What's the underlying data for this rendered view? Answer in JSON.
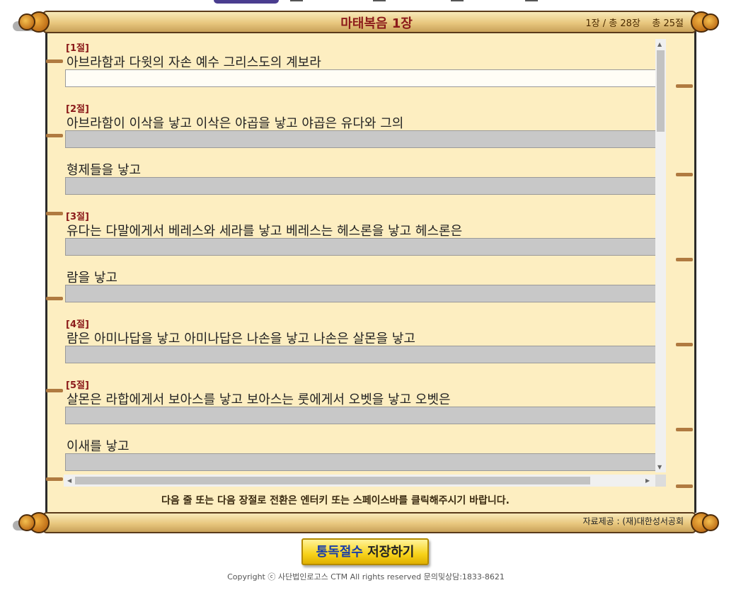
{
  "header": {
    "title": "마태복음 1장",
    "chapter_info": "1장 / 총 28장    총 25절"
  },
  "lines": [
    {
      "label": "[1절]",
      "text": "아브라함과 다윗의 자손 예수 그리스도의 계보라"
    },
    {
      "label": "[2절]",
      "text": "아브라함이 이삭을 낳고 이삭은 야곱을 낳고 야곱은 유다와 그의"
    },
    {
      "label": "",
      "text": "형제들을 낳고"
    },
    {
      "label": "[3절]",
      "text": "유다는 다말에게서 베레스와 세라를 낳고 베레스는 헤스론을 낳고 헤스론은"
    },
    {
      "label": "",
      "text": "람을 낳고"
    },
    {
      "label": "[4절]",
      "text": "람은 아미나답을 낳고 아미나답은 나손을 낳고 나손은 살몬을 낳고"
    },
    {
      "label": "[5절]",
      "text": "살몬은 라합에게서 보아스를 낳고 보아스는 룻에게서 오벳을 낳고 오벳은"
    },
    {
      "label": "",
      "text": "이새를 낳고"
    }
  ],
  "instruction": "다음 줄 또는 다음 장절로 전환은 엔터키 또는 스페이스바를 클릭해주시기 바랍니다.",
  "source": "자료제공 : (재)대한성서공회",
  "save_button": {
    "part1": "통독절수",
    "part2": " 저장하기"
  },
  "copyright": "Copyright ⓒ 사단법인로고스 CTM All rights reserved 문의및상담:1833-8621",
  "colors": {
    "title": "#8b1a1a",
    "paper": "#fdeec1",
    "button": "#f7d21a",
    "button_text_blue": "#1a3ea8"
  }
}
